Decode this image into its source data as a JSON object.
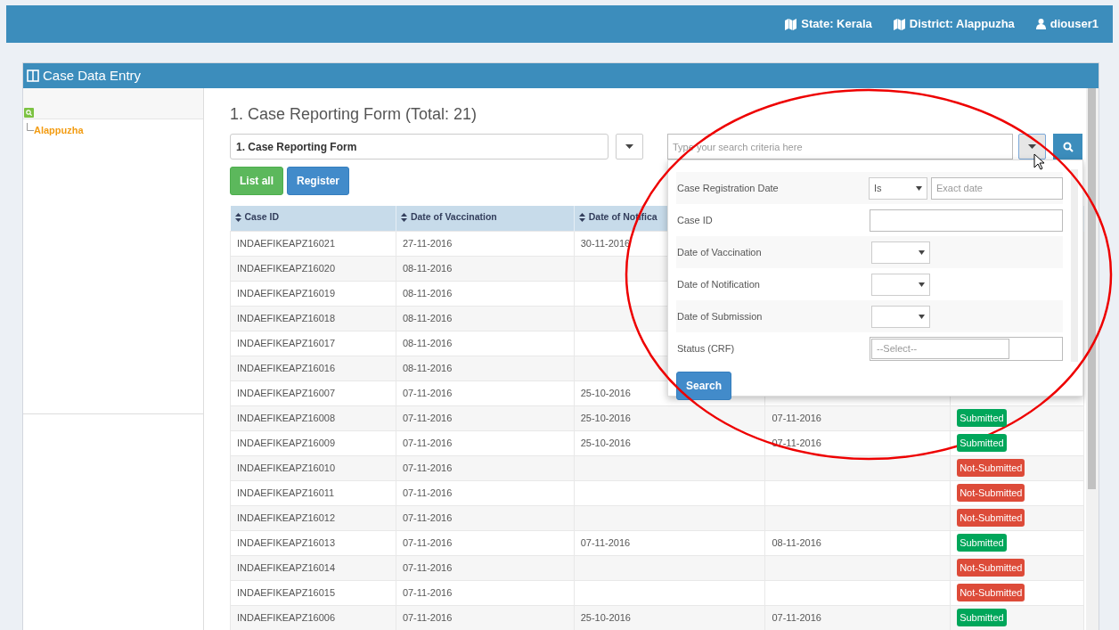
{
  "header": {
    "items": [
      {
        "kind": "map",
        "text": "State: Kerala"
      },
      {
        "kind": "map",
        "text": "District: Alappuzha"
      },
      {
        "kind": "user",
        "text": "diouser1"
      }
    ]
  },
  "panel": {
    "title": "Case Data Entry"
  },
  "tree": {
    "items": [
      {
        "label": "Alappuzha"
      }
    ]
  },
  "form": {
    "title": "1. Case Reporting Form (Total: 21)",
    "select_value": "1. Case Reporting Form",
    "buttons": [
      {
        "label": "List all",
        "kind": "success"
      },
      {
        "label": "Register",
        "kind": "primary"
      }
    ],
    "search": {
      "placeholder": "Type your search criteria here"
    }
  },
  "filter_dropdown": {
    "fields": [
      {
        "label": "Case Registration Date",
        "kind": "operator_date",
        "operator": "Is",
        "placeholder": "Exact date"
      },
      {
        "label": "Case ID",
        "kind": "text"
      },
      {
        "label": "Date of Vaccination",
        "kind": "select"
      },
      {
        "label": "Date of Notification",
        "kind": "select"
      },
      {
        "label": "Date of Submission",
        "kind": "select"
      },
      {
        "label": "Status (CRF)",
        "kind": "multiselect",
        "placeholder": "--Select--"
      }
    ],
    "submit": "Search"
  },
  "table": {
    "columns": [
      "Case ID",
      "Date of Vaccination",
      "Date of Notifica"
    ],
    "rows": [
      {
        "case_id": "INDAEFIKEAPZ16021",
        "vaccination": "27-11-2016",
        "column_3": "30-11-2016"
      },
      {
        "case_id": "INDAEFIKEAPZ16020",
        "vaccination": "08-11-2016"
      },
      {
        "case_id": "INDAEFIKEAPZ16019",
        "vaccination": "08-11-2016"
      },
      {
        "case_id": "INDAEFIKEAPZ16018",
        "vaccination": "08-11-2016"
      },
      {
        "case_id": "INDAEFIKEAPZ16017",
        "vaccination": "08-11-2016"
      },
      {
        "case_id": "INDAEFIKEAPZ16016",
        "vaccination": "08-11-2016"
      },
      {
        "case_id": "INDAEFIKEAPZ16007",
        "vaccination": "07-11-2016",
        "column_3": "25-10-2016"
      },
      {
        "case_id": "INDAEFIKEAPZ16008",
        "vaccination": "07-11-2016",
        "column_3": "25-10-2016",
        "column_4": "07-11-2016",
        "status": {
          "label": "Submitted",
          "submitted": true
        }
      },
      {
        "case_id": "INDAEFIKEAPZ16009",
        "vaccination": "07-11-2016",
        "column_3": "25-10-2016",
        "column_4": "07-11-2016",
        "status": {
          "label": "Submitted",
          "submitted": true
        }
      },
      {
        "case_id": "INDAEFIKEAPZ16010",
        "vaccination": "07-11-2016",
        "status": {
          "label": "Not-Submitted",
          "submitted": false
        }
      },
      {
        "case_id": "INDAEFIKEAPZ16011",
        "vaccination": "07-11-2016",
        "status": {
          "label": "Not-Submitted",
          "submitted": false
        }
      },
      {
        "case_id": "INDAEFIKEAPZ16012",
        "vaccination": "07-11-2016",
        "status": {
          "label": "Not-Submitted",
          "submitted": false
        }
      },
      {
        "case_id": "INDAEFIKEAPZ16013",
        "vaccination": "07-11-2016",
        "column_3": "07-11-2016",
        "column_4": "08-11-2016",
        "status": {
          "label": "Submitted",
          "submitted": true
        }
      },
      {
        "case_id": "INDAEFIKEAPZ16014",
        "vaccination": "07-11-2016",
        "status": {
          "label": "Not-Submitted",
          "submitted": false
        }
      },
      {
        "case_id": "INDAEFIKEAPZ16015",
        "vaccination": "07-11-2016",
        "status": {
          "label": "Not-Submitted",
          "submitted": false
        }
      },
      {
        "case_id": "INDAEFIKEAPZ16006",
        "vaccination": "07-11-2016",
        "column_3": "25-10-2016",
        "column_4": "07-11-2016",
        "status": {
          "label": "Submitted",
          "submitted": true
        }
      }
    ]
  }
}
